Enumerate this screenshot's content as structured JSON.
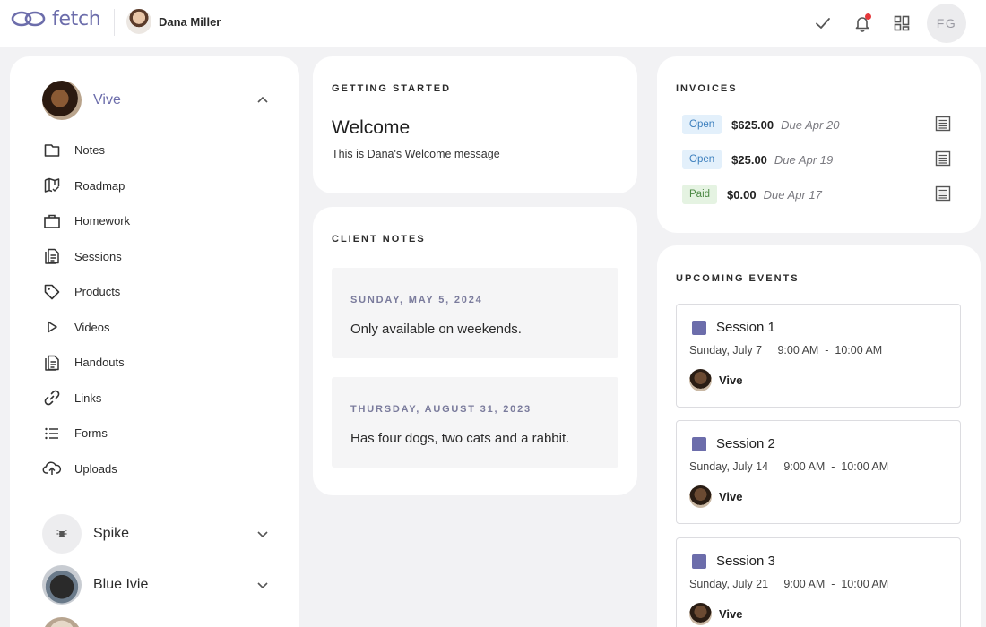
{
  "header": {
    "brand": "fetch",
    "user_name": "Dana Miller",
    "initials": "FG",
    "icons": [
      "check-icon",
      "bell-icon",
      "grid-icon"
    ],
    "notification_dot_color": "#e5383b"
  },
  "sidebar": {
    "active_pet": "Vive",
    "nav": [
      {
        "label": "Notes",
        "icon": "folder-icon"
      },
      {
        "label": "Roadmap",
        "icon": "map-icon"
      },
      {
        "label": "Homework",
        "icon": "briefcase-icon"
      },
      {
        "label": "Sessions",
        "icon": "document-icon"
      },
      {
        "label": "Products",
        "icon": "tag-icon"
      },
      {
        "label": "Videos",
        "icon": "play-icon"
      },
      {
        "label": "Handouts",
        "icon": "document-icon"
      },
      {
        "label": "Links",
        "icon": "link-icon"
      },
      {
        "label": "Forms",
        "icon": "list-icon"
      },
      {
        "label": "Uploads",
        "icon": "cloud-upload-icon"
      }
    ],
    "other_pets": [
      "Spike",
      "Blue Ivie"
    ]
  },
  "getting_started": {
    "title": "GETTING STARTED",
    "welcome_title": "Welcome",
    "welcome_message": "This is Dana's Welcome message"
  },
  "client_notes": {
    "title": "CLIENT NOTES",
    "notes": [
      {
        "date": "SUNDAY, MAY 5, 2024",
        "text": "Only available on weekends."
      },
      {
        "date": "THURSDAY, AUGUST 31, 2023",
        "text": "Has four dogs, two cats and a rabbit."
      }
    ]
  },
  "invoices": {
    "title": "INVOICES",
    "items": [
      {
        "status": "Open",
        "amount": "$625.00",
        "due": "Due Apr 20"
      },
      {
        "status": "Open",
        "amount": "$25.00",
        "due": "Due Apr 19"
      },
      {
        "status": "Paid",
        "amount": "$0.00",
        "due": "Due Apr 17"
      }
    ]
  },
  "upcoming_events": {
    "title": "UPCOMING EVENTS",
    "accent": "#6c6dab",
    "events": [
      {
        "title": "Session 1",
        "date": "Sunday, July 7",
        "start": "9:00 AM",
        "sep": "-",
        "end": "10:00 AM",
        "pet": "Vive"
      },
      {
        "title": "Session 2",
        "date": "Sunday, July 14",
        "start": "9:00 AM",
        "sep": "-",
        "end": "10:00 AM",
        "pet": "Vive"
      },
      {
        "title": "Session 3",
        "date": "Sunday, July 21",
        "start": "9:00 AM",
        "sep": "-",
        "end": "10:00 AM",
        "pet": "Vive"
      }
    ]
  }
}
